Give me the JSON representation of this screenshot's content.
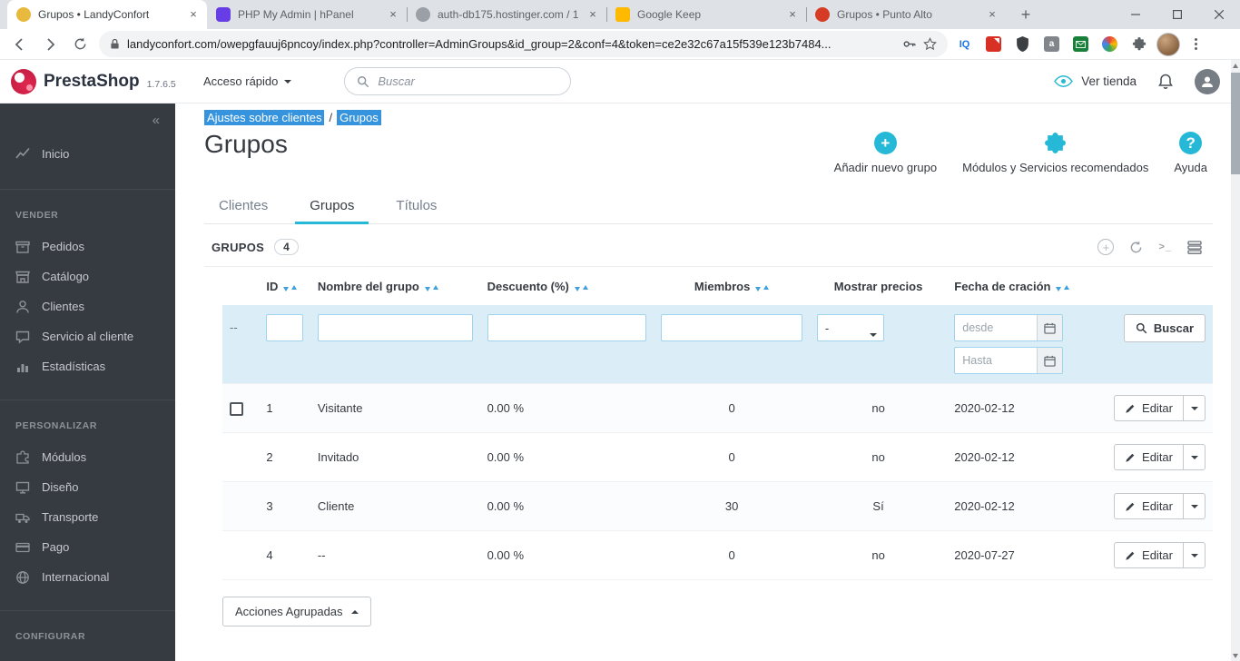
{
  "browser": {
    "tabs": [
      {
        "title": "Grupos • LandyConfort"
      },
      {
        "title": "PHP My Admin | hPanel"
      },
      {
        "title": "auth-db175.hostinger.com / 1..."
      },
      {
        "title": "Google Keep"
      },
      {
        "title": "Grupos • Punto Alto"
      }
    ],
    "url": "landyconfort.com/owepgfauuj6pncoy/index.php?controller=AdminGroups&id_group=2&conf=4&token=ce2e32c67a15f539e123b7484...",
    "extension_iq_label": "IQ"
  },
  "ps_header": {
    "brand": "PrestaShop",
    "version": "1.7.6.5",
    "quick_access": "Acceso rápido",
    "search_placeholder": "Buscar",
    "view_shop": "Ver tienda"
  },
  "breadcrumb": {
    "parent": "Ajustes sobre clientes",
    "separator": "/",
    "current": "Grupos"
  },
  "page": {
    "title": "Grupos",
    "actions": {
      "add": "Añadir nuevo grupo",
      "modules": "Módulos y Servicios recomendados",
      "help": "Ayuda"
    }
  },
  "nav_tabs": [
    {
      "label": "Clientes"
    },
    {
      "label": "Grupos"
    },
    {
      "label": "Títulos"
    }
  ],
  "panel": {
    "title": "GRUPOS",
    "count": "4"
  },
  "table": {
    "columns": [
      {
        "label": "ID"
      },
      {
        "label": "Nombre del grupo"
      },
      {
        "label": "Descuento (%)"
      },
      {
        "label": "Miembros"
      },
      {
        "label": "Mostrar precios"
      },
      {
        "label": "Fecha de cración"
      }
    ],
    "filter": {
      "prefix": "--",
      "select_value": "-",
      "date_from_placeholder": "desde",
      "date_to_placeholder": "Hasta",
      "search_label": "Buscar"
    },
    "rows": [
      {
        "id": "1",
        "name": "Visitante",
        "discount": "0.00 %",
        "members": "0",
        "show_prices": "no",
        "created": "2020-02-12",
        "edit_label": "Editar"
      },
      {
        "id": "2",
        "name": "Invitado",
        "discount": "0.00 %",
        "members": "0",
        "show_prices": "no",
        "created": "2020-02-12",
        "edit_label": "Editar"
      },
      {
        "id": "3",
        "name": "Cliente",
        "discount": "0.00 %",
        "members": "30",
        "show_prices": "Sí",
        "created": "2020-02-12",
        "edit_label": "Editar"
      },
      {
        "id": "4",
        "name": "--",
        "discount": "0.00 %",
        "members": "0",
        "show_prices": "no",
        "created": "2020-07-27",
        "edit_label": "Editar"
      }
    ],
    "bulk_actions_label": "Acciones Agrupadas"
  },
  "sidebar": {
    "collapse": "«",
    "home": "Inicio",
    "sections": [
      {
        "title": "VENDER",
        "items": [
          "Pedidos",
          "Catálogo",
          "Clientes",
          "Servicio al cliente",
          "Estadísticas"
        ]
      },
      {
        "title": "PERSONALIZAR",
        "items": [
          "Módulos",
          "Diseño",
          "Transporte",
          "Pago",
          "Internacional"
        ]
      },
      {
        "title": "CONFIGURAR",
        "items": []
      }
    ]
  },
  "colors": {
    "accent": "#25b9d7",
    "sidebar_bg": "#363a41",
    "selection": "#3693dd",
    "filter_bg": "#dbeef8"
  }
}
